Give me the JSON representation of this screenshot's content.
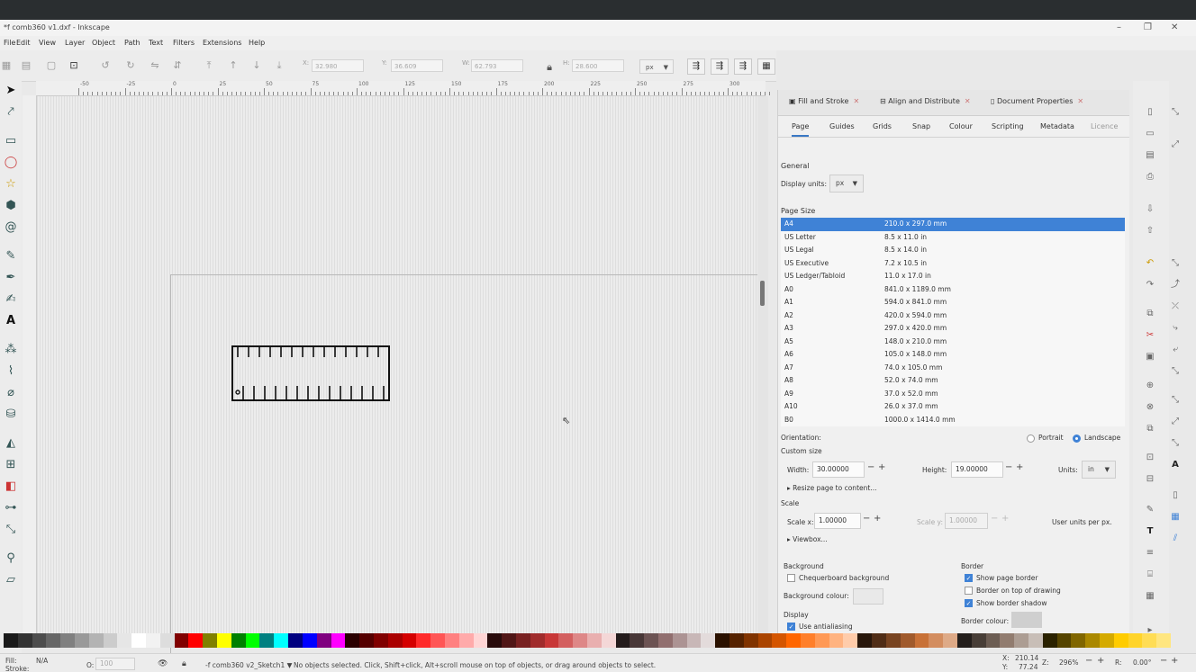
{
  "window": {
    "title": "*f comb360 v1.dxf - Inkscape",
    "min": "–",
    "max": "❐",
    "close": "✕"
  },
  "menu": [
    "File",
    "Edit",
    "View",
    "Layer",
    "Object",
    "Path",
    "Text",
    "Filters",
    "Extensions",
    "Help"
  ],
  "toolbar": {
    "x_label": "X:",
    "x_value": "32.980",
    "y_label": "Y:",
    "y_value": "36.609",
    "w_label": "W:",
    "w_value": "62.793",
    "h_label": "H:",
    "h_value": "28.600",
    "units": "px"
  },
  "ruler": {
    "labels": [
      "-50",
      "-25",
      "0",
      "25",
      "50",
      "75",
      "100",
      "125",
      "150",
      "175",
      "200",
      "225",
      "250",
      "275",
      "300"
    ]
  },
  "dock": {
    "tabs": [
      {
        "label": "Fill and Stroke"
      },
      {
        "label": "Align and Distribute"
      },
      {
        "label": "Document Properties"
      }
    ],
    "subtabs": [
      "Page",
      "Guides",
      "Grids",
      "Snap",
      "Colour",
      "Scripting",
      "Metadata",
      "Licence"
    ],
    "general_label": "General",
    "display_units_label": "Display units:",
    "display_units_value": "px",
    "page_size_label": "Page Size",
    "page_sizes": [
      {
        "name": "A4",
        "dims": "210.0 x 297.0 mm"
      },
      {
        "name": "US Letter",
        "dims": "8.5 x 11.0 in"
      },
      {
        "name": "US Legal",
        "dims": "8.5 x 14.0 in"
      },
      {
        "name": "US Executive",
        "dims": "7.2 x 10.5 in"
      },
      {
        "name": "US Ledger/Tabloid",
        "dims": "11.0 x 17.0 in"
      },
      {
        "name": "A0",
        "dims": "841.0 x 1189.0 mm"
      },
      {
        "name": "A1",
        "dims": "594.0 x 841.0 mm"
      },
      {
        "name": "A2",
        "dims": "420.0 x 594.0 mm"
      },
      {
        "name": "A3",
        "dims": "297.0 x 420.0 mm"
      },
      {
        "name": "A5",
        "dims": "148.0 x 210.0 mm"
      },
      {
        "name": "A6",
        "dims": "105.0 x 148.0 mm"
      },
      {
        "name": "A7",
        "dims": "74.0 x 105.0 mm"
      },
      {
        "name": "A8",
        "dims": "52.0 x 74.0 mm"
      },
      {
        "name": "A9",
        "dims": "37.0 x 52.0 mm"
      },
      {
        "name": "A10",
        "dims": "26.0 x 37.0 mm"
      },
      {
        "name": "B0",
        "dims": "1000.0 x 1414.0 mm"
      }
    ],
    "orientation_label": "Orientation:",
    "portrait_label": "Portrait",
    "landscape_label": "Landscape",
    "custom_size_label": "Custom size",
    "width_label": "Width:",
    "width_value": "30.00000",
    "height_label": "Height:",
    "height_value": "19.00000",
    "units_label": "Units:",
    "units_value": "in",
    "resize_label": "Resize page to content...",
    "scale_label": "Scale",
    "scale_x_label": "Scale x:",
    "scale_x_value": "1.00000",
    "scale_y_label": "Scale y:",
    "scale_y_value": "1.00000",
    "user_units_label": "User units per px.",
    "viewbox_label": "Viewbox...",
    "background_label": "Background",
    "checkerboard_label": "Chequerboard background",
    "bg_colour_label": "Background colour:",
    "border_label": "Border",
    "show_border_label": "Show page border",
    "border_on_top_label": "Border on top of drawing",
    "show_shadow_label": "Show border shadow",
    "border_colour_label": "Border colour:",
    "display_label": "Display",
    "antialias_label": "Use antialiasing"
  },
  "status": {
    "fill_label": "Fill:",
    "fill_value": "N/A",
    "stroke_label": "Stroke:",
    "opacity_label": "O:",
    "opacity_value": "100",
    "layer": "-f comb360 v2_Sketch1",
    "message": "No objects selected. Click, Shift+click, Alt+scroll mouse on top of objects, or drag around objects to select.",
    "x_label": "X:",
    "x_value": "210.14",
    "y_label": "Y:",
    "y_value": "77.24",
    "zoom_label": "Z:",
    "zoom_value": "296%",
    "rotate_label": "R:",
    "rotate_value": "0.00°"
  },
  "colors": {
    "accent": "#3f82d6",
    "selection": "#3f82d6"
  }
}
